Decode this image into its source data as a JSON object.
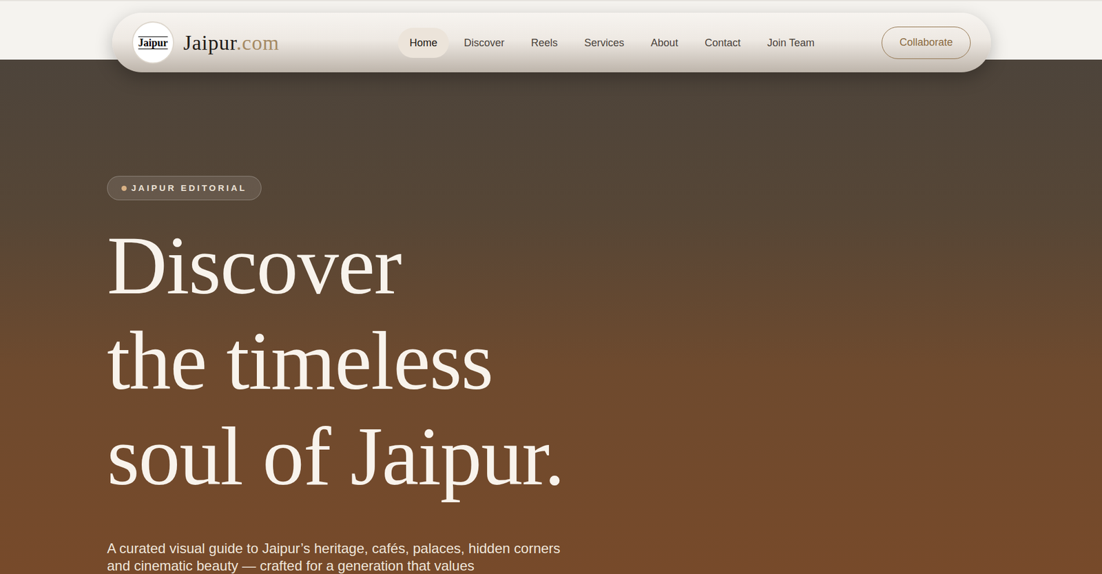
{
  "logo": {
    "mark": "Jaipur"
  },
  "brand": {
    "name": "Jaipur",
    "suffix": ".com"
  },
  "nav": [
    {
      "label": "Home",
      "selected": true
    },
    {
      "label": "Discover",
      "selected": false
    },
    {
      "label": "Reels",
      "selected": false
    },
    {
      "label": "Services",
      "selected": false
    },
    {
      "label": "About",
      "selected": false
    },
    {
      "label": "Contact",
      "selected": false
    },
    {
      "label": "Join Team",
      "selected": false
    }
  ],
  "cta": "Collaborate",
  "hero": {
    "badge": "JAIPUR EDITORIAL",
    "title_lines": [
      "Discover",
      "the timeless",
      "soul of Jaipur."
    ],
    "description": "A curated visual guide to Jaipur’s heritage, cafés, palaces, hidden corners and cinematic beauty — crafted for a generation that values"
  }
}
